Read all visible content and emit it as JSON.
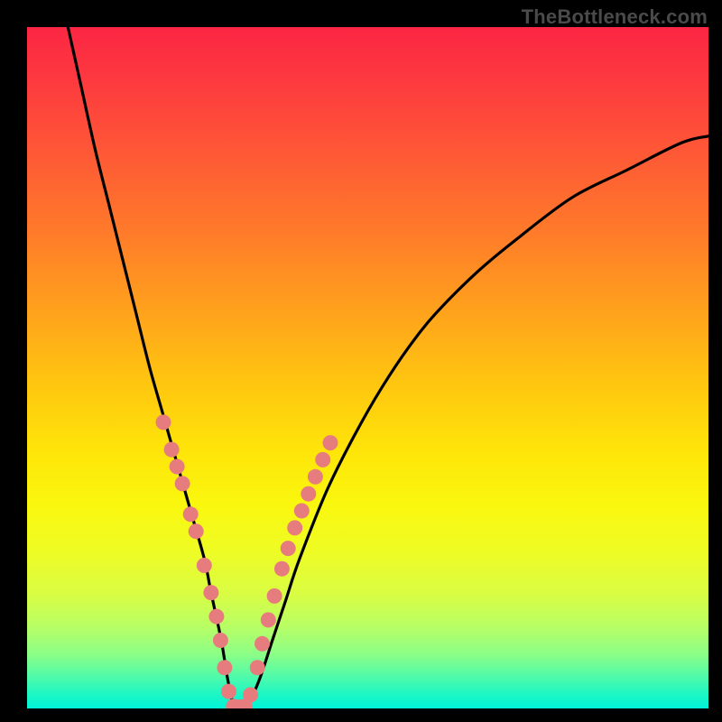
{
  "watermark": "TheBottleneck.com",
  "chart_data": {
    "type": "line",
    "title": "",
    "xlabel": "",
    "ylabel": "",
    "xlim": [
      0,
      100
    ],
    "ylim": [
      0,
      100
    ],
    "grid": false,
    "legend": false,
    "series": [
      {
        "name": "bottleneck-curve",
        "color": "#000000",
        "x": [
          6,
          8,
          10,
          12,
          14,
          16,
          18,
          20,
          22,
          24,
          26,
          27,
          28.5,
          29.5,
          30.5,
          32,
          34,
          36,
          38,
          40,
          44,
          48,
          52,
          56,
          60,
          66,
          72,
          80,
          88,
          96,
          100
        ],
        "y": [
          100,
          91,
          82,
          74,
          66,
          58,
          50,
          43,
          36,
          29,
          22,
          17,
          10,
          4,
          0,
          0,
          4,
          10,
          16,
          22,
          32,
          40,
          47,
          53,
          58,
          64,
          69,
          75,
          79,
          83,
          84
        ]
      }
    ],
    "markers": [
      {
        "name": "pink-dots",
        "color": "#e77c7f",
        "points": [
          {
            "x": 20.0,
            "y": 42.0
          },
          {
            "x": 21.2,
            "y": 38.0
          },
          {
            "x": 22.0,
            "y": 35.5
          },
          {
            "x": 22.8,
            "y": 33.0
          },
          {
            "x": 24.0,
            "y": 28.5
          },
          {
            "x": 24.8,
            "y": 26.0
          },
          {
            "x": 26.0,
            "y": 21.0
          },
          {
            "x": 27.0,
            "y": 17.0
          },
          {
            "x": 27.8,
            "y": 13.5
          },
          {
            "x": 28.4,
            "y": 10.0
          },
          {
            "x": 29.0,
            "y": 6.0
          },
          {
            "x": 29.6,
            "y": 2.5
          },
          {
            "x": 30.3,
            "y": 0.3
          },
          {
            "x": 31.2,
            "y": 0.2
          },
          {
            "x": 32.0,
            "y": 0.3
          },
          {
            "x": 32.8,
            "y": 2.0
          },
          {
            "x": 33.8,
            "y": 6.0
          },
          {
            "x": 34.5,
            "y": 9.5
          },
          {
            "x": 35.4,
            "y": 13.0
          },
          {
            "x": 36.3,
            "y": 16.5
          },
          {
            "x": 37.4,
            "y": 20.5
          },
          {
            "x": 38.3,
            "y": 23.5
          },
          {
            "x": 39.3,
            "y": 26.5
          },
          {
            "x": 40.3,
            "y": 29.0
          },
          {
            "x": 41.3,
            "y": 31.5
          },
          {
            "x": 42.3,
            "y": 34.0
          },
          {
            "x": 43.4,
            "y": 36.5
          },
          {
            "x": 44.5,
            "y": 39.0
          }
        ]
      }
    ],
    "gradient_stops": [
      {
        "pos": 0.0,
        "color": "#fb2643"
      },
      {
        "pos": 0.3,
        "color": "#ff7a2a"
      },
      {
        "pos": 0.62,
        "color": "#fee409"
      },
      {
        "pos": 0.88,
        "color": "#b8fe65"
      },
      {
        "pos": 1.0,
        "color": "#00f3d8"
      }
    ]
  }
}
